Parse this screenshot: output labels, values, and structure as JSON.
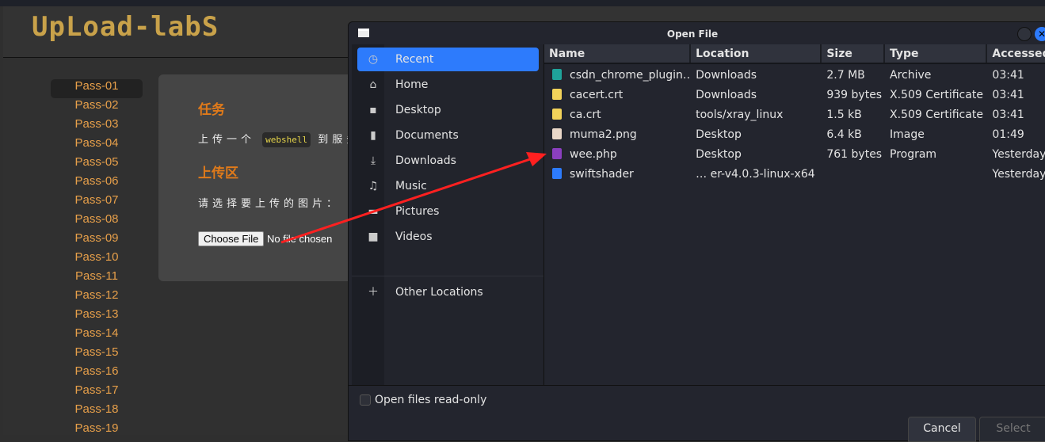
{
  "site": {
    "logo": "UpLoad-labS",
    "nav": [
      "Pass-01",
      "Pass-02",
      "Pass-03",
      "Pass-04",
      "Pass-05",
      "Pass-06",
      "Pass-07",
      "Pass-08",
      "Pass-09",
      "Pass-10",
      "Pass-11",
      "Pass-12",
      "Pass-13",
      "Pass-14",
      "Pass-15",
      "Pass-16",
      "Pass-17",
      "Pass-18",
      "Pass-19"
    ],
    "task_title": "任务",
    "task_pre": "上传一个",
    "task_code": "webshell",
    "task_post": "到服务",
    "upload_title": "上传区",
    "upload_prompt": "请选择要上传的图片：",
    "choose_file": "Choose File",
    "no_file": "No file chosen"
  },
  "dialog": {
    "title": "Open File",
    "places": [
      {
        "icon": "clock-icon",
        "label": "Recent"
      },
      {
        "icon": "home-icon",
        "label": "Home"
      },
      {
        "icon": "desktop-icon",
        "label": "Desktop"
      },
      {
        "icon": "document-icon",
        "label": "Documents"
      },
      {
        "icon": "download-icon",
        "label": "Downloads"
      },
      {
        "icon": "music-icon",
        "label": "Music"
      },
      {
        "icon": "picture-icon",
        "label": "Pictures"
      },
      {
        "icon": "video-icon",
        "label": "Videos"
      }
    ],
    "other_locations": "Other Locations",
    "columns": [
      "Name",
      "Location",
      "Size",
      "Type",
      "Accessed"
    ],
    "files": [
      {
        "name": "csdn_chrome_plugin…",
        "location": "Downloads",
        "size": "2.7 MB",
        "type": "Archive",
        "accessed": "03:41",
        "color": "#1fa39a"
      },
      {
        "name": "cacert.crt",
        "location": "Downloads",
        "size": "939 bytes",
        "type": "X.509 Certificate",
        "accessed": "03:41",
        "color": "#f2d25a"
      },
      {
        "name": "ca.crt",
        "location": "tools/xray_linux",
        "size": "1.5 kB",
        "type": "X.509 Certificate",
        "accessed": "03:41",
        "color": "#f2d25a"
      },
      {
        "name": "muma2.png",
        "location": "Desktop",
        "size": "6.4 kB",
        "type": "Image",
        "accessed": "01:49",
        "color": "#e9d7c8"
      },
      {
        "name": "wee.php",
        "location": "Desktop",
        "size": "761 bytes",
        "type": "Program",
        "accessed": "Yesterday",
        "color": "#8a3fbf"
      },
      {
        "name": "swiftshader",
        "location": "… er-v4.0.3-linux-x64",
        "size": "",
        "type": "",
        "accessed": "Yesterday",
        "color": "#2d7bfc"
      }
    ],
    "readonly_label": "Open files read-only",
    "cancel": "Cancel",
    "select": "Select"
  }
}
